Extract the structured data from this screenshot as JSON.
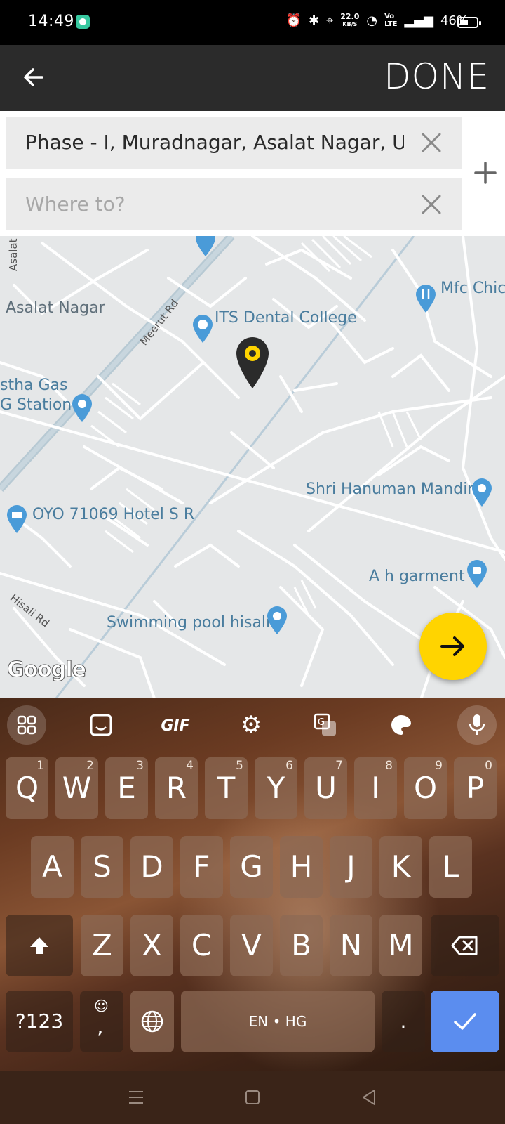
{
  "status_bar": {
    "time": "14:49",
    "net_speed": "22.0",
    "net_unit": "KB/S",
    "battery": "46%"
  },
  "app_bar": {
    "done_label": "DONE"
  },
  "search": {
    "from_value": "Phase - I, Muradnagar, Asalat Nagar, Ut",
    "to_placeholder": "Where to?"
  },
  "map": {
    "labels": {
      "asalat_nagar_vertical": "Asalat N",
      "asalat_nagar": "Asalat Nagar",
      "meerut_rd": "Meerut Rd",
      "its_dental": "ITS Dental College",
      "mfc": "Mfc Chic",
      "gas_station_1": "stha Gas",
      "gas_station_2": "G Station",
      "shri_hanuman": "Shri Hanuman Mandir",
      "oyo_hotel": "OYO 71069 Hotel S R",
      "ah_garment": "A h garment",
      "hisali_rd": "Hisali Rd",
      "swimming_pool": "Swimming pool hisali",
      "google": "Google"
    }
  },
  "keyboard": {
    "toolbar_gif": "GIF",
    "row1": [
      {
        "k": "Q",
        "h": "1"
      },
      {
        "k": "W",
        "h": "2"
      },
      {
        "k": "E",
        "h": "3"
      },
      {
        "k": "R",
        "h": "4"
      },
      {
        "k": "T",
        "h": "5"
      },
      {
        "k": "Y",
        "h": "6"
      },
      {
        "k": "U",
        "h": "7"
      },
      {
        "k": "I",
        "h": "8"
      },
      {
        "k": "O",
        "h": "9"
      },
      {
        "k": "P",
        "h": "0"
      }
    ],
    "row2": [
      "A",
      "S",
      "D",
      "F",
      "G",
      "H",
      "J",
      "K",
      "L"
    ],
    "row3": [
      "Z",
      "X",
      "C",
      "V",
      "B",
      "N",
      "M"
    ],
    "symbols_label": "?123",
    "emoji_comma": ",",
    "space_label": "EN • HG",
    "period": "."
  },
  "colors": {
    "accent_yellow": "#ffd400",
    "enter_blue": "#5b8def",
    "app_bar": "#2b2b2b"
  }
}
